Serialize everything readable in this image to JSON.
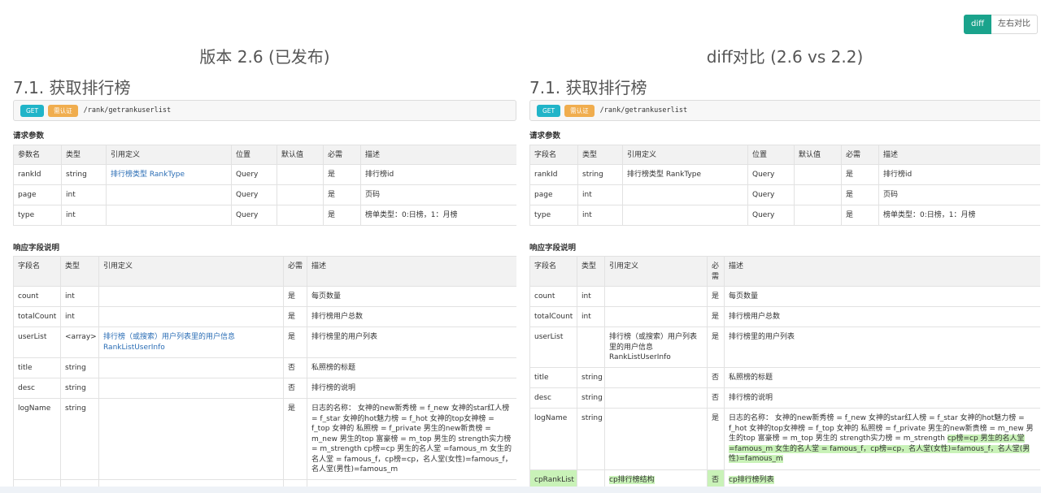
{
  "toggle": {
    "diff": "diff",
    "side_by_side": "左右对比"
  },
  "left": {
    "version_title": "版本 2.6 (已发布)",
    "section_title": "7.1. 获取排行榜",
    "method": "GET",
    "auth": "需认证",
    "path": "/rank/getrankuserlist",
    "req_label": "请求参数",
    "req_headers": [
      "参数名",
      "类型",
      "引用定义",
      "位置",
      "默认值",
      "必需",
      "描述"
    ],
    "req_rows": [
      [
        "rankId",
        "string",
        "排行榜类型 RankType",
        "Query",
        "",
        "是",
        "排行榜id"
      ],
      [
        "page",
        "int",
        "",
        "Query",
        "",
        "是",
        "页码"
      ],
      [
        "type",
        "int",
        "",
        "Query",
        "",
        "是",
        "榜单类型：0:日榜，1：月榜"
      ]
    ],
    "resp_label": "响应字段说明",
    "resp_headers": [
      "字段名",
      "类型",
      "引用定义",
      "必需",
      "描述"
    ],
    "resp_rows": [
      [
        "count",
        "int",
        "",
        "是",
        "每页数量"
      ],
      [
        "totalCount",
        "int",
        "",
        "是",
        "排行榜用户总数"
      ],
      [
        "userList",
        "<array>",
        "排行榜（或搜索）用户列表里的用户信息 RankListUserInfo",
        "是",
        "排行榜里的用户列表"
      ],
      [
        "title",
        "string",
        "",
        "否",
        "私照榜的标题"
      ],
      [
        "desc",
        "string",
        "",
        "否",
        "排行榜的说明"
      ],
      [
        "logName",
        "string",
        "",
        "是",
        "日志的名称： 女神的new新秀榜 = f_new   女神的star红人榜 = f_star   女神的hot魅力榜 = f_hot   女神的top女神榜 = f_top   女神的 私照榜 = f_private    男生的new新贵榜 = m_new    男生的top 富豪榜 = m_top  男生的 strength实力榜 = m_strength cp榜=cp 男生的名人堂 =famous_m 女生的名人堂 = famous_f，cp榜=cp，名人堂(女性)=famous_f，名人堂(男性)=famous_m"
      ]
    ]
  },
  "right": {
    "version_title": "diff对比 (2.6 vs 2.2)",
    "section_title": "7.1. 获取排行榜",
    "method": "GET",
    "auth": "需认证",
    "path": "/rank/getrankuserlist",
    "req_label": "请求参数",
    "req_headers": [
      "字段名",
      "类型",
      "引用定义",
      "位置",
      "默认值",
      "必需",
      "描述"
    ],
    "req_rows": [
      [
        "rankId",
        "string",
        "排行榜类型 RankType",
        "Query",
        "",
        "是",
        "排行榜id"
      ],
      [
        "page",
        "int",
        "",
        "Query",
        "",
        "是",
        "页码"
      ],
      [
        "type",
        "int",
        "",
        "Query",
        "",
        "是",
        "榜单类型：0:日榜，1：月榜"
      ]
    ],
    "resp_label": "响应字段说明",
    "resp_headers": [
      "字段名",
      "类型",
      "引用定义",
      "必需",
      "描述"
    ],
    "resp_rows": [
      [
        "count",
        "int",
        "",
        "是",
        "每页数量"
      ],
      [
        "totalCount",
        "int",
        "",
        "是",
        "排行榜用户总数"
      ],
      [
        "userList",
        "",
        "排行榜（或搜索）用户列表里的用户信息 RankListUserInfo",
        "是",
        "排行榜里的用户列表"
      ],
      [
        "title",
        "string",
        "",
        "否",
        "私照榜的标题"
      ],
      [
        "desc",
        "string",
        "",
        "否",
        "排行榜的说明"
      ],
      [
        "logName",
        "string",
        "",
        "是",
        ""
      ],
      [
        "cpRankList",
        "",
        "cp排行榜结构",
        "否",
        "cp排行榜列表"
      ]
    ],
    "logname_plain": "日志的名称： 女神的new新秀榜 = f_new 女神的star红人榜 = f_star 女神的hot魅力榜 = f_hot 女神的top女神榜 = f_top 女神的 私照榜 = f_private 男生的new新贵榜 = m_new 男生的top 富豪榜 = m_top 男生的 strength实力榜 = m_strength ",
    "logname_added": "cp榜=cp 男生的名人堂 =famous_m 女生的名人堂 = famous_f，cp榜=cp，名人堂(女性)=famous_f，名人堂(男性)=famous_m"
  }
}
